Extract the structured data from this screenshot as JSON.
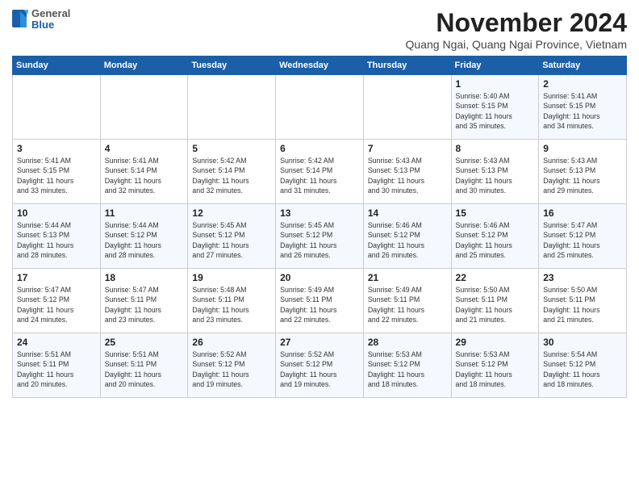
{
  "logo": {
    "general": "General",
    "blue": "Blue"
  },
  "title": "November 2024",
  "subtitle": "Quang Ngai, Quang Ngai Province, Vietnam",
  "days_of_week": [
    "Sunday",
    "Monday",
    "Tuesday",
    "Wednesday",
    "Thursday",
    "Friday",
    "Saturday"
  ],
  "weeks": [
    [
      {
        "num": "",
        "info": ""
      },
      {
        "num": "",
        "info": ""
      },
      {
        "num": "",
        "info": ""
      },
      {
        "num": "",
        "info": ""
      },
      {
        "num": "",
        "info": ""
      },
      {
        "num": "1",
        "info": "Sunrise: 5:40 AM\nSunset: 5:15 PM\nDaylight: 11 hours\nand 35 minutes."
      },
      {
        "num": "2",
        "info": "Sunrise: 5:41 AM\nSunset: 5:15 PM\nDaylight: 11 hours\nand 34 minutes."
      }
    ],
    [
      {
        "num": "3",
        "info": "Sunrise: 5:41 AM\nSunset: 5:15 PM\nDaylight: 11 hours\nand 33 minutes."
      },
      {
        "num": "4",
        "info": "Sunrise: 5:41 AM\nSunset: 5:14 PM\nDaylight: 11 hours\nand 32 minutes."
      },
      {
        "num": "5",
        "info": "Sunrise: 5:42 AM\nSunset: 5:14 PM\nDaylight: 11 hours\nand 32 minutes."
      },
      {
        "num": "6",
        "info": "Sunrise: 5:42 AM\nSunset: 5:14 PM\nDaylight: 11 hours\nand 31 minutes."
      },
      {
        "num": "7",
        "info": "Sunrise: 5:43 AM\nSunset: 5:13 PM\nDaylight: 11 hours\nand 30 minutes."
      },
      {
        "num": "8",
        "info": "Sunrise: 5:43 AM\nSunset: 5:13 PM\nDaylight: 11 hours\nand 30 minutes."
      },
      {
        "num": "9",
        "info": "Sunrise: 5:43 AM\nSunset: 5:13 PM\nDaylight: 11 hours\nand 29 minutes."
      }
    ],
    [
      {
        "num": "10",
        "info": "Sunrise: 5:44 AM\nSunset: 5:13 PM\nDaylight: 11 hours\nand 28 minutes."
      },
      {
        "num": "11",
        "info": "Sunrise: 5:44 AM\nSunset: 5:12 PM\nDaylight: 11 hours\nand 28 minutes."
      },
      {
        "num": "12",
        "info": "Sunrise: 5:45 AM\nSunset: 5:12 PM\nDaylight: 11 hours\nand 27 minutes."
      },
      {
        "num": "13",
        "info": "Sunrise: 5:45 AM\nSunset: 5:12 PM\nDaylight: 11 hours\nand 26 minutes."
      },
      {
        "num": "14",
        "info": "Sunrise: 5:46 AM\nSunset: 5:12 PM\nDaylight: 11 hours\nand 26 minutes."
      },
      {
        "num": "15",
        "info": "Sunrise: 5:46 AM\nSunset: 5:12 PM\nDaylight: 11 hours\nand 25 minutes."
      },
      {
        "num": "16",
        "info": "Sunrise: 5:47 AM\nSunset: 5:12 PM\nDaylight: 11 hours\nand 25 minutes."
      }
    ],
    [
      {
        "num": "17",
        "info": "Sunrise: 5:47 AM\nSunset: 5:12 PM\nDaylight: 11 hours\nand 24 minutes."
      },
      {
        "num": "18",
        "info": "Sunrise: 5:47 AM\nSunset: 5:11 PM\nDaylight: 11 hours\nand 23 minutes."
      },
      {
        "num": "19",
        "info": "Sunrise: 5:48 AM\nSunset: 5:11 PM\nDaylight: 11 hours\nand 23 minutes."
      },
      {
        "num": "20",
        "info": "Sunrise: 5:49 AM\nSunset: 5:11 PM\nDaylight: 11 hours\nand 22 minutes."
      },
      {
        "num": "21",
        "info": "Sunrise: 5:49 AM\nSunset: 5:11 PM\nDaylight: 11 hours\nand 22 minutes."
      },
      {
        "num": "22",
        "info": "Sunrise: 5:50 AM\nSunset: 5:11 PM\nDaylight: 11 hours\nand 21 minutes."
      },
      {
        "num": "23",
        "info": "Sunrise: 5:50 AM\nSunset: 5:11 PM\nDaylight: 11 hours\nand 21 minutes."
      }
    ],
    [
      {
        "num": "24",
        "info": "Sunrise: 5:51 AM\nSunset: 5:11 PM\nDaylight: 11 hours\nand 20 minutes."
      },
      {
        "num": "25",
        "info": "Sunrise: 5:51 AM\nSunset: 5:11 PM\nDaylight: 11 hours\nand 20 minutes."
      },
      {
        "num": "26",
        "info": "Sunrise: 5:52 AM\nSunset: 5:12 PM\nDaylight: 11 hours\nand 19 minutes."
      },
      {
        "num": "27",
        "info": "Sunrise: 5:52 AM\nSunset: 5:12 PM\nDaylight: 11 hours\nand 19 minutes."
      },
      {
        "num": "28",
        "info": "Sunrise: 5:53 AM\nSunset: 5:12 PM\nDaylight: 11 hours\nand 18 minutes."
      },
      {
        "num": "29",
        "info": "Sunrise: 5:53 AM\nSunset: 5:12 PM\nDaylight: 11 hours\nand 18 minutes."
      },
      {
        "num": "30",
        "info": "Sunrise: 5:54 AM\nSunset: 5:12 PM\nDaylight: 11 hours\nand 18 minutes."
      }
    ]
  ]
}
